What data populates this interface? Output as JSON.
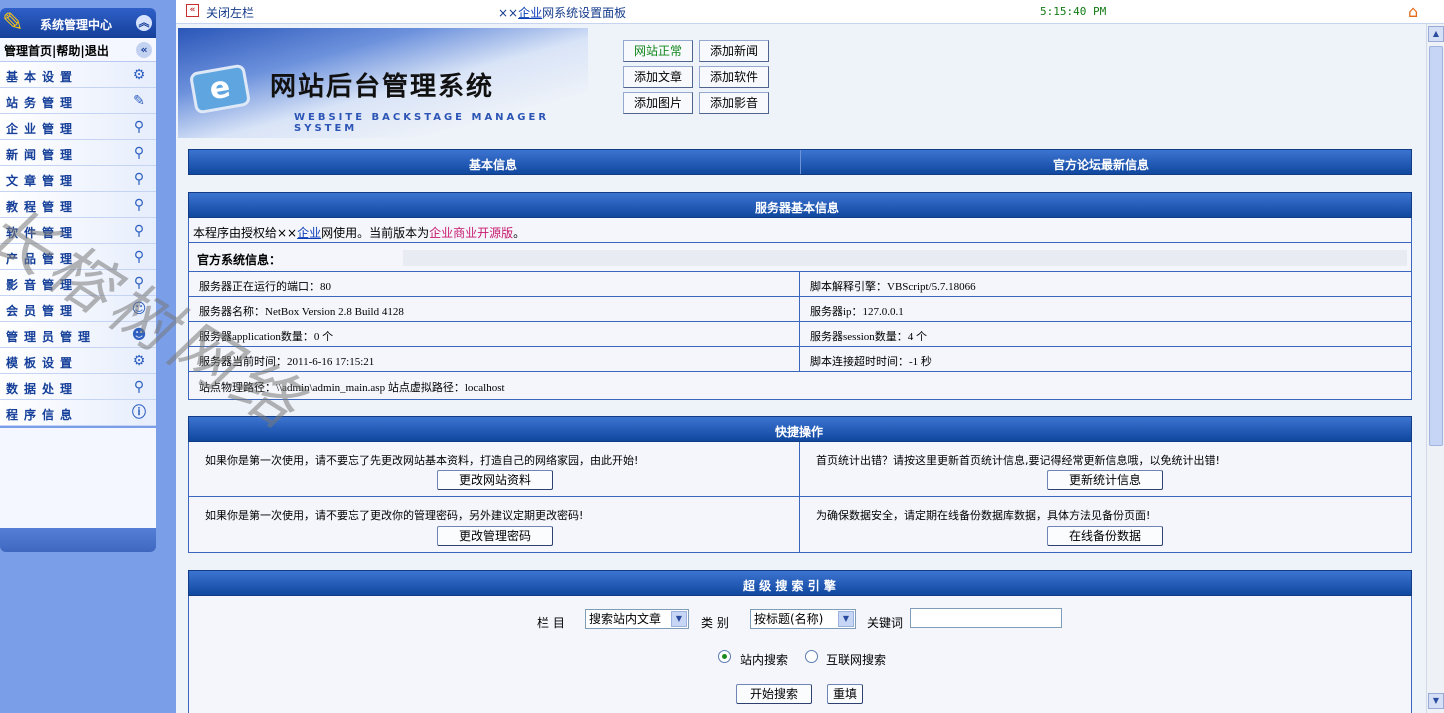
{
  "sidebar": {
    "title": "系统管理中心",
    "top_links": [
      "管理首页",
      "帮助",
      "退出"
    ],
    "items": [
      {
        "label": "基本设置",
        "icon": "gear-icon"
      },
      {
        "label": "站务管理",
        "icon": "broom-icon"
      },
      {
        "label": "企业管理",
        "icon": "magnifier-icon"
      },
      {
        "label": "新闻管理",
        "icon": "magnifier-icon"
      },
      {
        "label": "文章管理",
        "icon": "magnifier-icon"
      },
      {
        "label": "教程管理",
        "icon": "magnifier-icon"
      },
      {
        "label": "软件管理",
        "icon": "magnifier-icon"
      },
      {
        "label": "产品管理",
        "icon": "magnifier-icon"
      },
      {
        "label": "影音管理",
        "icon": "magnifier-icon"
      },
      {
        "label": "会员管理",
        "icon": "user-icon"
      },
      {
        "label": "管理员管理",
        "icon": "admin-user-icon"
      },
      {
        "label": "模板设置",
        "icon": "gear-icon"
      },
      {
        "label": "数据处理",
        "icon": "magnifier-icon"
      },
      {
        "label": "程序信息",
        "icon": "info-icon"
      }
    ]
  },
  "topbar": {
    "close_left": "关闭左栏",
    "title_prefix": "××",
    "title_link": "企业",
    "title_suffix": "网系统设置面板",
    "time": "5:15:40 PM"
  },
  "banner": {
    "title": "网站后台管理系统",
    "subtitle": "WEBSITE BACKSTAGE MANAGER SYSTEM",
    "logo_letter": "e"
  },
  "quick_buttons": [
    "网站正常",
    "添加新闻",
    "添加文章",
    "添加软件",
    "添加图片",
    "添加影音"
  ],
  "info_bar": {
    "left": "基本信息",
    "right": "官方论坛最新信息"
  },
  "server": {
    "header": "服务器基本信息",
    "license_prefix": "本程序由授权给××",
    "license_link": "企业",
    "license_mid": "网使用。当前版本为",
    "license_version": "企业商业开源版",
    "license_end": "。",
    "official_label": "官方系统信息：",
    "port": "服务器正在运行的端口：80",
    "engine": "脚本解释引擎：VBScript/5.7.18066",
    "name": "服务器名称：NetBox Version 2.8 Build 4128",
    "ip": "服务器ip：127.0.0.1",
    "app_count": "服务器application数量：0 个",
    "session_count": "服务器session数量：4 个",
    "current_time": "服务器当前时间：2011-6-16 17:15:21",
    "timeout": "脚本连接超时时间：-1 秒",
    "path": "站点物理路径：\\\\admin\\admin_main.asp 站点虚拟路径：localhost"
  },
  "quick_ops": {
    "header": "快捷操作",
    "tip1": "如果你是第一次使用，请不要忘了先更改网站基本资料，打造自己的网络家园，由此开始!",
    "btn1": "更改网站资料",
    "tip2": "首页统计出错？请按这里更新首页统计信息,要记得经常更新信息哦，以免统计出错!",
    "btn2": "更新统计信息",
    "tip3": "如果你是第一次使用，请不要忘了更改你的管理密码，另外建议定期更改密码!",
    "btn3": "更改管理密码",
    "tip4": "为确保数据安全，请定期在线备份数据库数据，具体方法见备份页面!",
    "btn4": "在线备份数据"
  },
  "search": {
    "header": "超 级 搜 索 引 擎",
    "column_label": "栏 目",
    "column_value": "搜索站内文章",
    "type_label": "类 别",
    "type_value": "按标题(名称)",
    "keyword_label": "关键词",
    "radio_site": "站内搜索",
    "radio_web": "互联网搜索",
    "search_btn": "开始搜索",
    "reset_btn": "重填"
  },
  "watermark": "长榕树网络"
}
